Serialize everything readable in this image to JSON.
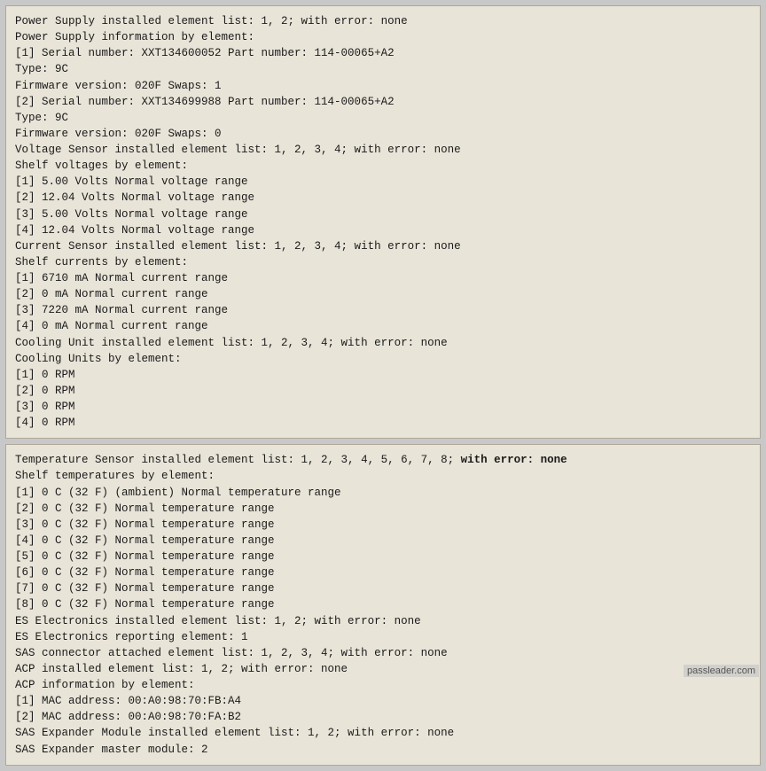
{
  "panel1": {
    "lines": [
      {
        "text": "Power Supply installed element list: 1, 2; with error: none",
        "bold": false
      },
      {
        "text": "Power Supply information by element:",
        "bold": false
      },
      {
        "text": "[1] Serial number: XXT134600052 Part number: 114-00065+A2",
        "bold": false
      },
      {
        "text": "Type: 9C",
        "bold": false
      },
      {
        "text": "Firmware version: 020F Swaps: 1",
        "bold": false
      },
      {
        "text": "[2] Serial number: XXT134699988 Part number: 114-00065+A2",
        "bold": false
      },
      {
        "text": "Type: 9C",
        "bold": false
      },
      {
        "text": "Firmware version: 020F Swaps: 0",
        "bold": false
      },
      {
        "text": "Voltage Sensor installed element list: 1, 2, 3, 4; with error: none",
        "bold": false
      },
      {
        "text": "Shelf voltages by element:",
        "bold": false
      },
      {
        "text": "[1] 5.00 Volts Normal voltage range",
        "bold": false
      },
      {
        "text": "[2] 12.04 Volts Normal voltage range",
        "bold": false
      },
      {
        "text": "[3] 5.00 Volts Normal voltage range",
        "bold": false
      },
      {
        "text": "[4] 12.04 Volts Normal voltage range",
        "bold": false
      },
      {
        "text": "Current Sensor installed element list: 1, 2, 3, 4; with error: none",
        "bold": false
      },
      {
        "text": "Shelf currents by element:",
        "bold": false
      },
      {
        "text": "[1] 6710 mA Normal current range",
        "bold": false
      },
      {
        "text": "[2] 0 mA Normal current range",
        "bold": false
      },
      {
        "text": "[3] 7220 mA Normal current range",
        "bold": false
      },
      {
        "text": "[4] 0 mA Normal current range",
        "bold": false
      },
      {
        "text": "Cooling Unit installed element list: 1, 2, 3, 4; with error: none",
        "bold": false
      },
      {
        "text": "Cooling Units by element:",
        "bold": false
      },
      {
        "text": "[1] 0 RPM",
        "bold": false
      },
      {
        "text": "[2] 0 RPM",
        "bold": false
      },
      {
        "text": "[3] 0 RPM",
        "bold": false
      },
      {
        "text": "[4] 0 RPM",
        "bold": false
      }
    ]
  },
  "panel2": {
    "lines": [
      {
        "text": "Temperature Sensor installed element list: 1, 2, 3, 4, 5, 6, 7, 8; ",
        "bold": false,
        "bold_suffix": "with error: none"
      },
      {
        "text": "Shelf temperatures by element:",
        "bold": false
      },
      {
        "text": "[1] 0 C (32 F) (ambient) Normal temperature range",
        "bold": false
      },
      {
        "text": "[2] 0 C (32 F) Normal temperature range",
        "bold": false
      },
      {
        "text": "[3] 0 C (32 F) Normal temperature range",
        "bold": false
      },
      {
        "text": "[4] 0 C (32 F) Normal temperature range",
        "bold": false
      },
      {
        "text": "[5] 0 C (32 F) Normal temperature range",
        "bold": false
      },
      {
        "text": "[6] 0 C (32 F) Normal temperature range",
        "bold": false
      },
      {
        "text": "[7] 0 C (32 F) Normal temperature range",
        "bold": false
      },
      {
        "text": "[8] 0 C (32 F) Normal temperature range",
        "bold": false
      },
      {
        "text": "ES Electronics installed element list: 1, 2; with error: none",
        "bold": false
      },
      {
        "text": "ES Electronics reporting element: 1",
        "bold": false
      },
      {
        "text": "SAS connector attached element list: 1, 2, 3, 4; with error: none",
        "bold": false
      },
      {
        "text": "ACP installed element list: 1, 2; with error: none",
        "bold": false
      },
      {
        "text": "ACP information by element:",
        "bold": false
      },
      {
        "text": "[1] MAC address: 00:A0:98:70:FB:A4",
        "bold": false
      },
      {
        "text": "[2] MAC address: 00:A0:98:70:FA:B2",
        "bold": false
      },
      {
        "text": "SAS Expander Module installed element list: 1, 2; with error: none",
        "bold": false
      },
      {
        "text": "SAS Expander master module: 2",
        "bold": false
      }
    ]
  },
  "watermark": "passleader.com"
}
